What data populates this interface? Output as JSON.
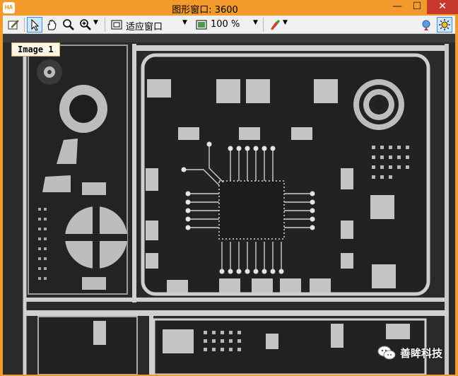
{
  "window": {
    "app_logo": "HA",
    "title": "图形窗口: 3600",
    "minimize": "—",
    "maximize": "☐",
    "close": "✕"
  },
  "toolbar": {
    "zoom_mode": "适应窗口",
    "zoom_percent": "100 %"
  },
  "image": {
    "label": "Image 1"
  },
  "watermark": {
    "text": "善眸科技"
  },
  "colors": {
    "title_bg": "#f39a2c",
    "board_bg": "#2b2b2b",
    "pad": "#c9c9c9",
    "trace": "#d9d9d9"
  }
}
